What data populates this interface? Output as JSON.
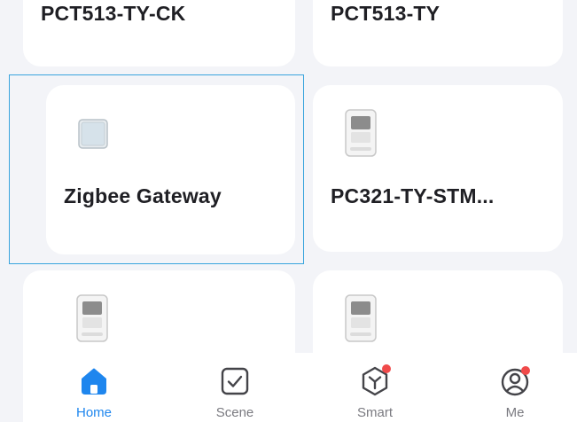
{
  "devices": [
    {
      "name": "PCT513-TY-CK"
    },
    {
      "name": "PCT513-TY"
    },
    {
      "name": "Zigbee Gateway"
    },
    {
      "name": "PC321-TY-STM..."
    }
  ],
  "tabs": [
    {
      "label": "Home",
      "icon": "home-icon",
      "active": true
    },
    {
      "label": "Scene",
      "icon": "scene-checkbox-icon",
      "active": false
    },
    {
      "label": "Smart",
      "icon": "smart-hexagon-icon",
      "active": false,
      "badge": true
    },
    {
      "label": "Me",
      "icon": "profile-icon",
      "active": false,
      "badge": true
    }
  ],
  "colors": {
    "accent": "#1e86ee",
    "badge": "#f04a4a",
    "selection_outline": "#39a4dd",
    "background": "#f3f4f8"
  }
}
